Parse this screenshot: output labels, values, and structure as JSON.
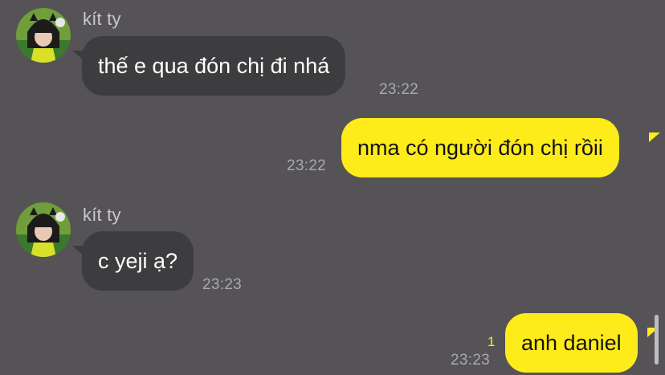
{
  "colors": {
    "background": "#555355",
    "incoming_bubble": "#3d3c3e",
    "outgoing_bubble": "#fdeb1a",
    "unread_indicator": "#fdeb1a"
  },
  "messages": [
    {
      "direction": "incoming",
      "sender": "kít ty",
      "avatar_icon": "profile-photo",
      "text": "thế e qua đón chị đi nhá",
      "time": "23:22"
    },
    {
      "direction": "outgoing",
      "text": "nma có người đón chị rồii",
      "time": "23:22"
    },
    {
      "direction": "incoming",
      "sender": "kít ty",
      "avatar_icon": "profile-photo",
      "text": "c yeji ạ?",
      "time": "23:23"
    },
    {
      "direction": "outgoing",
      "text": "anh daniel",
      "time": "23:23",
      "unread_count": "1"
    }
  ]
}
